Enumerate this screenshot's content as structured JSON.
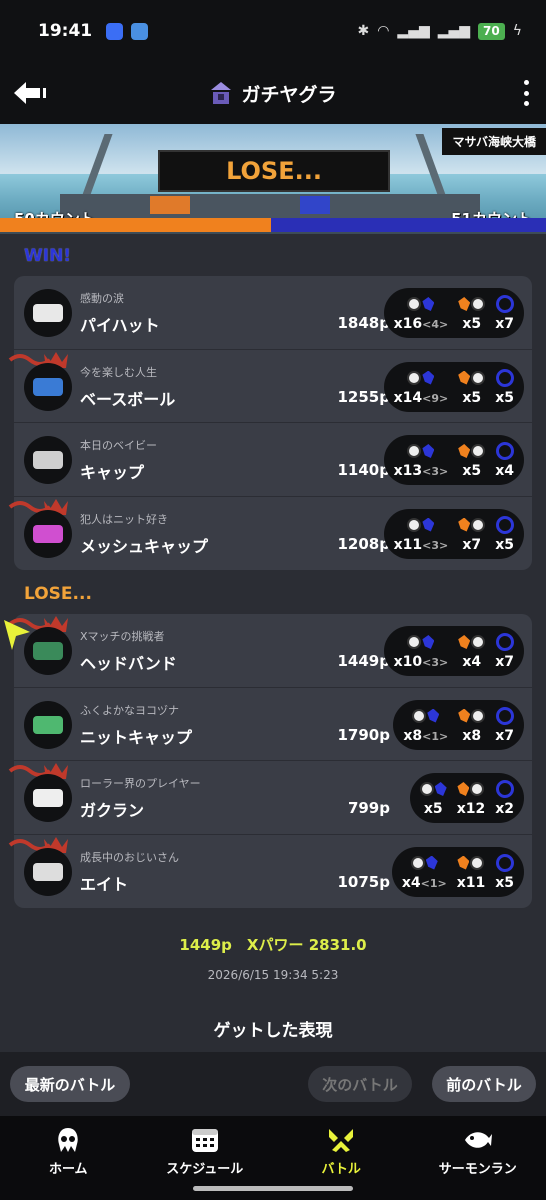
{
  "status": {
    "time": "19:41",
    "battery": "70",
    "app_colors": [
      "#3b6ef5",
      "#4a90e2"
    ]
  },
  "header": {
    "mode_title": "ガチヤグラ",
    "icons": {
      "back": "back-arrow-icon",
      "more": "more-vert-icon",
      "mode": "tower-icon"
    }
  },
  "stage": {
    "name": "マサバ海峡大橋",
    "result": "LOSE...",
    "left_count": "50カウント",
    "right_count": "51カウント",
    "colors": {
      "left": "#f0811e",
      "right": "#2a2fb6"
    }
  },
  "sections": {
    "win_label": "WIN!",
    "lose_label": "LOSE..."
  },
  "win_team": [
    {
      "title": "感動の涙",
      "name": "パイハット",
      "points": "1848p",
      "kills": "x16",
      "assists": "<4>",
      "specials_used": "x5",
      "special": "x7",
      "crown": false
    },
    {
      "title": "今を楽しむ人生",
      "name": "ベースボール",
      "points": "1255p",
      "kills": "x14",
      "assists": "<9>",
      "specials_used": "x5",
      "special": "x5",
      "crown": true
    },
    {
      "title": "本日のベイビー",
      "name": "キャップ",
      "points": "1140p",
      "kills": "x13",
      "assists": "<3>",
      "specials_used": "x5",
      "special": "x4",
      "crown": false
    },
    {
      "title": "犯人はニット好き",
      "name": "メッシュキャップ",
      "points": "1208p",
      "kills": "x11",
      "assists": "<3>",
      "specials_used": "x7",
      "special": "x5",
      "crown": true
    }
  ],
  "lose_team": [
    {
      "title": "Xマッチの挑戦者",
      "name": "ヘッドバンド",
      "points": "1449p",
      "kills": "x10",
      "assists": "<3>",
      "specials_used": "x4",
      "special": "x7",
      "crown": true,
      "is_self": true
    },
    {
      "title": "ふくよかなヨコヅナ",
      "name": "ニットキャップ",
      "points": "1790p",
      "kills": "x8",
      "assists": "<1>",
      "specials_used": "x8",
      "special": "x7",
      "crown": false
    },
    {
      "title": "ローラー界のプレイヤー",
      "name": "ガクラン",
      "points": "799p",
      "kills": "x5",
      "assists": "",
      "specials_used": "x12",
      "special": "x2",
      "crown": true
    },
    {
      "title": "成長中のおじいさん",
      "name": "エイト",
      "points": "1075p",
      "kills": "x4",
      "assists": "<1>",
      "specials_used": "x11",
      "special": "x5",
      "crown": true
    }
  ],
  "summary": {
    "line": "1449p　Xパワー 2831.0",
    "datetime": "2026/6/15 19:34 5:23",
    "gear_title": "ゲットした表現"
  },
  "buttons": {
    "latest": "最新のバトル",
    "next": "次のバトル",
    "prev": "前のバトル"
  },
  "tabs": [
    {
      "label": "ホーム",
      "icon": "squid-icon"
    },
    {
      "label": "スケジュール",
      "icon": "calendar-icon"
    },
    {
      "label": "バトル",
      "icon": "battle-icon",
      "active": true
    },
    {
      "label": "サーモンラン",
      "icon": "salmon-icon"
    }
  ]
}
